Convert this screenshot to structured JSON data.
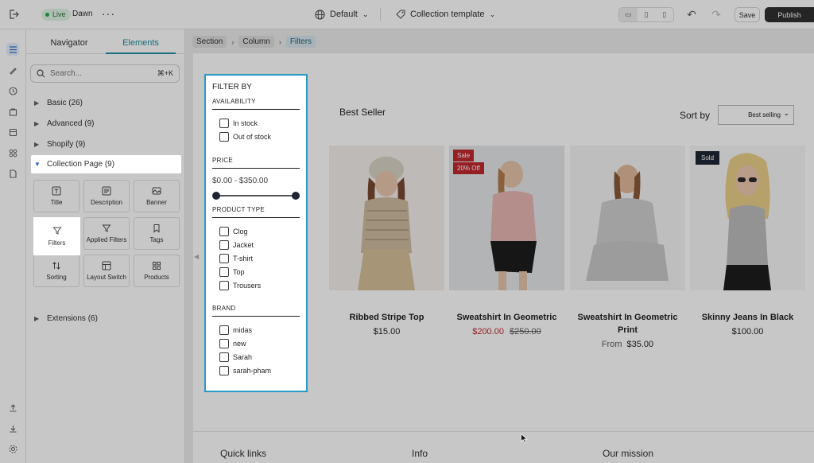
{
  "topbar": {
    "live_label": "Live",
    "theme_name": "Dawn",
    "language": "Default",
    "template": "Collection template",
    "save_label": "Save",
    "publish_label": "Publish"
  },
  "panel": {
    "tabs": [
      "Navigator",
      "Elements"
    ],
    "active_tab": "Elements",
    "search_placeholder": "Search...",
    "search_shortcut": "⌘+K",
    "categories": [
      {
        "label": "Basic (26)"
      },
      {
        "label": "Advanced (9)"
      },
      {
        "label": "Shopify (9)"
      },
      {
        "label": "Collection Page (9)"
      },
      {
        "label": "Extensions (6)"
      }
    ],
    "tiles": [
      {
        "label": "Title",
        "icon": "title-icon"
      },
      {
        "label": "Description",
        "icon": "description-icon"
      },
      {
        "label": "Banner",
        "icon": "banner-icon"
      },
      {
        "label": "Filters",
        "icon": "filter-icon"
      },
      {
        "label": "Applied Filters",
        "icon": "applied-filter-icon"
      },
      {
        "label": "Tags",
        "icon": "tag-icon"
      },
      {
        "label": "Sorting",
        "icon": "sort-icon"
      },
      {
        "label": "Layout Switch",
        "icon": "layout-icon"
      },
      {
        "label": "Products",
        "icon": "grid-icon"
      }
    ]
  },
  "breadcrumb": [
    "Section",
    "Column",
    "Filters"
  ],
  "store": {
    "heading": "Best Seller",
    "sort_label": "Sort by",
    "sort_value": "Best selling",
    "products": [
      {
        "name": "Ribbed Stripe Top",
        "price": "$15.00"
      },
      {
        "name": "Sweatshirt In Geometric",
        "sale_price": "$200.00",
        "compare_price": "$250.00",
        "badge1": "Sale",
        "badge2": "20% Off"
      },
      {
        "name": "Sweatshirt In Geometric Print",
        "from_label": "From",
        "price": "$35.00"
      },
      {
        "name": "Skinny Jeans In Black",
        "price": "$100.00",
        "badge1": "Sold"
      }
    ],
    "footer": [
      "Quick links",
      "Info",
      "Our mission"
    ]
  },
  "filter": {
    "title": "FILTER BY",
    "availability_label": "AVAILABILITY",
    "availability": [
      "In stock",
      "Out of stock"
    ],
    "price_label": "PRICE",
    "price_range": "$0.00 - $350.00",
    "product_type_label": "PRODUCT TYPE",
    "product_types": [
      "Clog",
      "Jacket",
      "T-shirt",
      "Top",
      "Trousers"
    ],
    "brand_label": "BRAND",
    "brands": [
      "midas",
      "new",
      "Sarah",
      "sarah-pham"
    ]
  }
}
